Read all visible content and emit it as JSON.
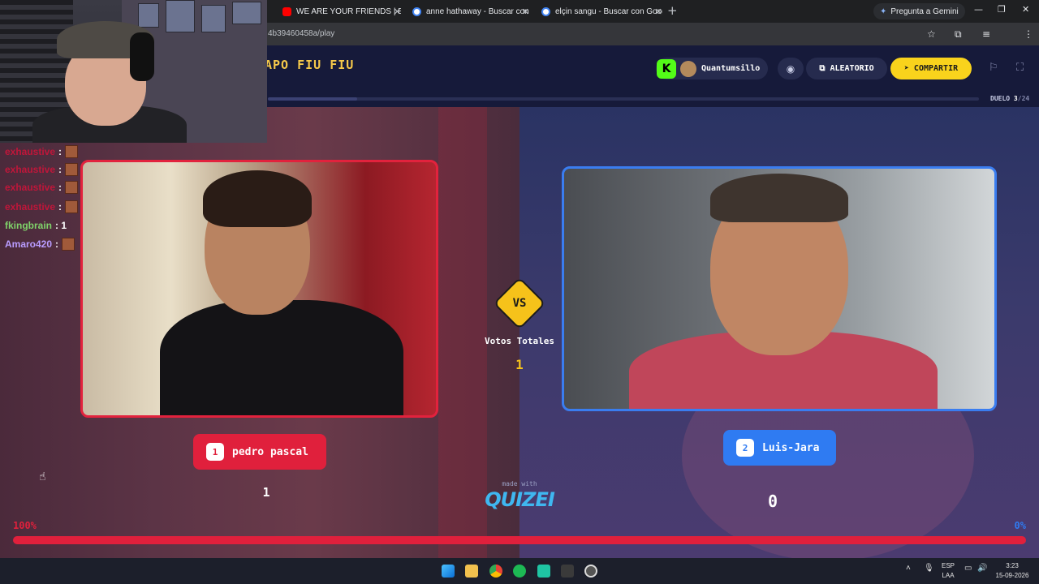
{
  "browser": {
    "tabs": [
      {
        "label": "WE ARE YOUR FRIENDS | Emily",
        "icon": "youtube-icon",
        "icon_color": "#ff0000"
      },
      {
        "label": "anne hathaway - Buscar con Go",
        "icon": "google-icon",
        "icon_color": "#4285f4"
      },
      {
        "label": "elçin sangu - Buscar con Google",
        "icon": "google-icon",
        "icon_color": "#4285f4"
      }
    ],
    "new_tab": "+",
    "gemini_label": "Pregunta a Gemini",
    "url": "4b39460458a/play"
  },
  "app": {
    "title": "APO FIU FIU",
    "user": {
      "platform_badge": "K",
      "name": "Quantumsillo"
    },
    "random_label": "ALEATORIO",
    "share_label": "COMPARTIR",
    "duel": {
      "label": "DUELO",
      "current": "3",
      "total": "/24"
    },
    "progress_fraction": 0.125
  },
  "duel": {
    "vs_label": "VS",
    "total_votes_label": "Votos Totales",
    "total_votes": "1",
    "left": {
      "index": "1",
      "name": "pedro pascal",
      "votes": "1",
      "percent": "100%",
      "color": "#e0203c"
    },
    "right": {
      "index": "2",
      "name": "Luis-Jara",
      "votes": "0",
      "percent": "0%",
      "color": "#2f7bf2"
    },
    "vote_share_left": 1.0,
    "made_with": "made with",
    "brand": "QUIZEI"
  },
  "stream_chat": [
    {
      "user": "exhaustive",
      "text": ":",
      "color": "#c0163a"
    },
    {
      "user": "exhaustive",
      "text": ":",
      "color": "#c0163a"
    },
    {
      "user": "exhaustive",
      "text": ":",
      "color": "#c0163a"
    },
    {
      "user": "exhaustive",
      "text": ":",
      "color": "#c0163a"
    },
    {
      "user": "fkingbrain",
      "text": ": 1",
      "color": "#7fd36a"
    },
    {
      "user": "Amaro420",
      "text": ":",
      "color": "#b99cff"
    }
  ],
  "taskbar": {
    "lang_top": "ESP",
    "lang_bottom": "LAA",
    "time": "3:23",
    "date": "15-09-2026"
  }
}
